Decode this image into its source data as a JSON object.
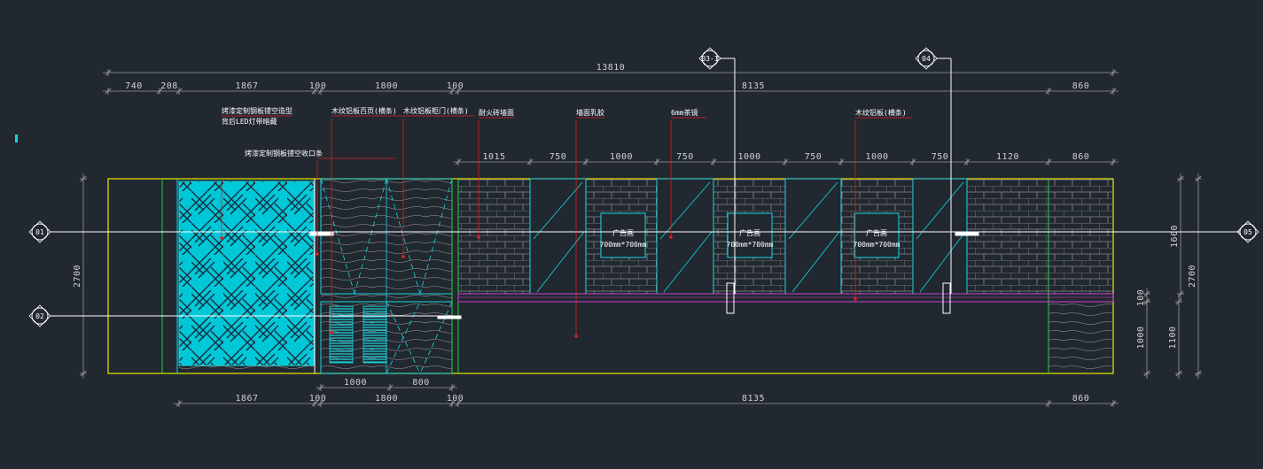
{
  "drawing": {
    "total_width": "13810",
    "top_dims": [
      "740",
      "208",
      "1867",
      "100",
      "1800",
      "100",
      "8135",
      "860"
    ],
    "mid_dims": [
      "1015",
      "750",
      "1000",
      "750",
      "1000",
      "750",
      "1000",
      "750",
      "1120",
      "860"
    ],
    "bottom_dims_a": [
      "1000",
      "800"
    ],
    "bottom_dims_b": [
      "1867",
      "100",
      "1800",
      "100",
      "8135",
      "860"
    ],
    "left_height": "2700",
    "right_dims": [
      "1600",
      "2700",
      "100",
      "1100",
      "1000"
    ],
    "section_markers": [
      "03-1",
      "04"
    ],
    "grid_markers": [
      "01",
      "02",
      "05"
    ],
    "labels": [
      "烤漆定制钢板镂空造型",
      "背后LED灯带暗藏",
      "烤漆定制钢板镂空收口条",
      "木纹铝板百页(横条)",
      "木纹铝板柜门(横条)",
      "耐火砖墙面",
      "墙面乳胶",
      "6mm茶镜",
      "木纹铝板(横条)"
    ],
    "ad_title": "广告画",
    "ad_size_1": "700mm*700mm",
    "ad_size_2": "700mm*700mm",
    "ad_size_3": "700mm*700mm"
  },
  "colors": {
    "background": "#212830",
    "outline": "#e8e800",
    "cyan": "#19d6e0",
    "green": "#2ecc40",
    "magenta": "#d040d0",
    "red": "#e02020",
    "white": "#ffffff",
    "gray": "#9a9a9a"
  }
}
